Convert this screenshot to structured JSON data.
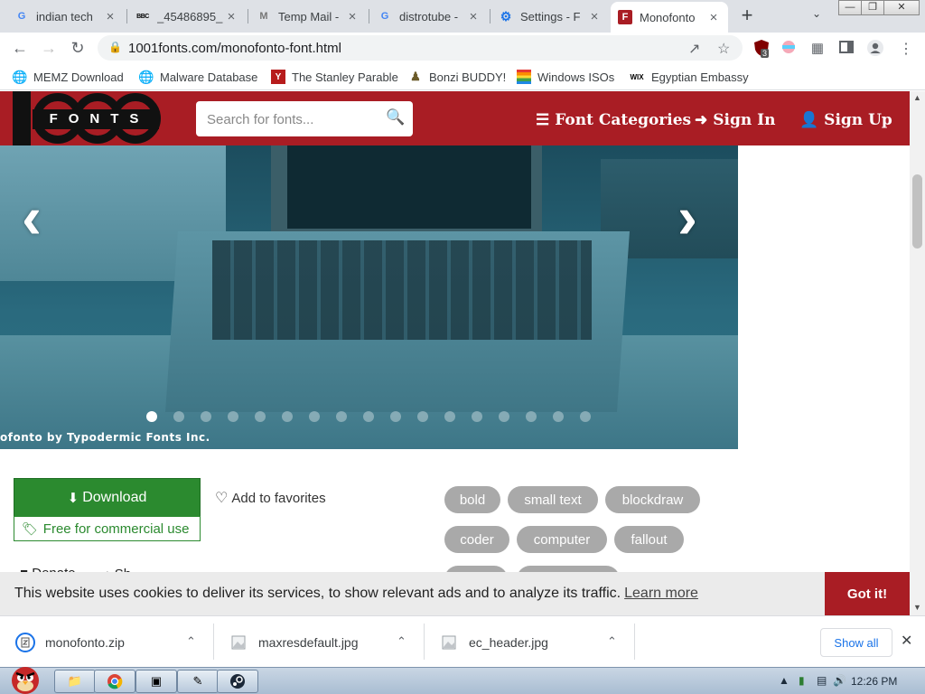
{
  "browser": {
    "tabs": [
      {
        "title": "indian tech",
        "favicon": "G",
        "favicon_color": "#4285f4"
      },
      {
        "title": "_45486895_",
        "favicon": "BBC",
        "favicon_color": "#000000"
      },
      {
        "title": "Temp Mail -",
        "favicon": "M",
        "favicon_color": "#888888"
      },
      {
        "title": "distrotube -",
        "favicon": "G",
        "favicon_color": "#4285f4"
      },
      {
        "title": "Settings - F",
        "favicon": "⚙",
        "favicon_color": "#1a73e8"
      },
      {
        "title": "Monofonto",
        "favicon": "F",
        "favicon_color": "#a91d24",
        "active": true
      }
    ],
    "new_tab": "+",
    "url": "1001fonts.com/monofonto-font.html",
    "ext_badge": "3",
    "bookmarks": [
      {
        "label": "MEMZ Download",
        "icon": "globe-icon"
      },
      {
        "label": "Malware Database",
        "icon": "globe-icon"
      },
      {
        "label": "The Stanley Parable",
        "icon": "stanley-icon"
      },
      {
        "label": "Bonzi BUDDY!",
        "icon": "bonzi-icon"
      },
      {
        "label": "Windows ISOs",
        "icon": "windows-icon"
      },
      {
        "label": "Egyptian Embassy",
        "icon": "wix-icon",
        "icon_text": "WIX"
      }
    ]
  },
  "site": {
    "logo_text": "FONTS",
    "search_placeholder": "Search for fonts...",
    "nav": {
      "categories": "Font Categories",
      "sign_in": "Sign In",
      "sign_up": "Sign Up"
    },
    "brand_color": "#a91d24",
    "carousel": {
      "slide_count": 17,
      "active_index": 0,
      "caption": "ofonto by Typodermic Fonts Inc."
    },
    "download_label": "Download",
    "license_label": "Free for commercial use",
    "favorites_label": "Add to favorites",
    "tags": [
      {
        "label": "bold"
      },
      {
        "label": "small text"
      },
      {
        "label": "blockdraw"
      },
      {
        "label": "coder"
      },
      {
        "label": "computer"
      },
      {
        "label": "fallout"
      }
    ],
    "partial_links": [
      "Donate",
      "Sh"
    ],
    "cookie": {
      "message": "This website uses cookies to deliver its services, to show relevant ads and to analyze its traffic.",
      "learn_more": "Learn more",
      "accept": "Got it!"
    }
  },
  "downloads": {
    "items": [
      {
        "name": "monofonto.zip",
        "icon": "zip-file-icon"
      },
      {
        "name": "maxresdefault.jpg",
        "icon": "image-file-icon"
      },
      {
        "name": "ec_header.jpg",
        "icon": "image-file-icon"
      }
    ],
    "show_all": "Show all"
  },
  "taskbar": {
    "clock": "12:26 PM"
  }
}
